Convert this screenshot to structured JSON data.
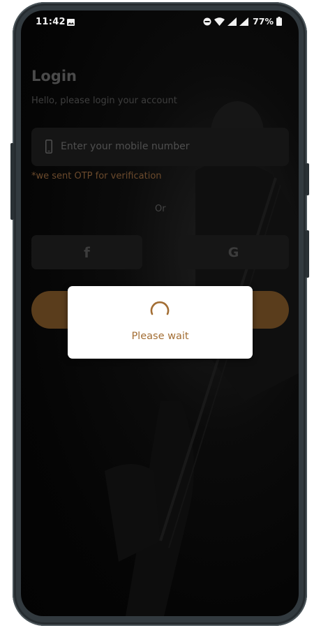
{
  "status_bar": {
    "time": "11:42",
    "battery": "77%",
    "icons": [
      "image-icon",
      "dnd-icon",
      "wifi-icon",
      "signal-icon",
      "signal-icon",
      "battery-icon"
    ]
  },
  "login": {
    "title": "Login",
    "subtitle": "Hello, please login your account",
    "mobile_placeholder": "Enter your mobile number",
    "otp_note": "*we sent OTP for verification",
    "or_text": "Or",
    "facebook_glyph": "f",
    "google_glyph": "G"
  },
  "dialog": {
    "message": "Please wait"
  },
  "colors": {
    "accent": "#a36e34",
    "login_button": "#5a3d1c",
    "frame": "#323a3f"
  }
}
